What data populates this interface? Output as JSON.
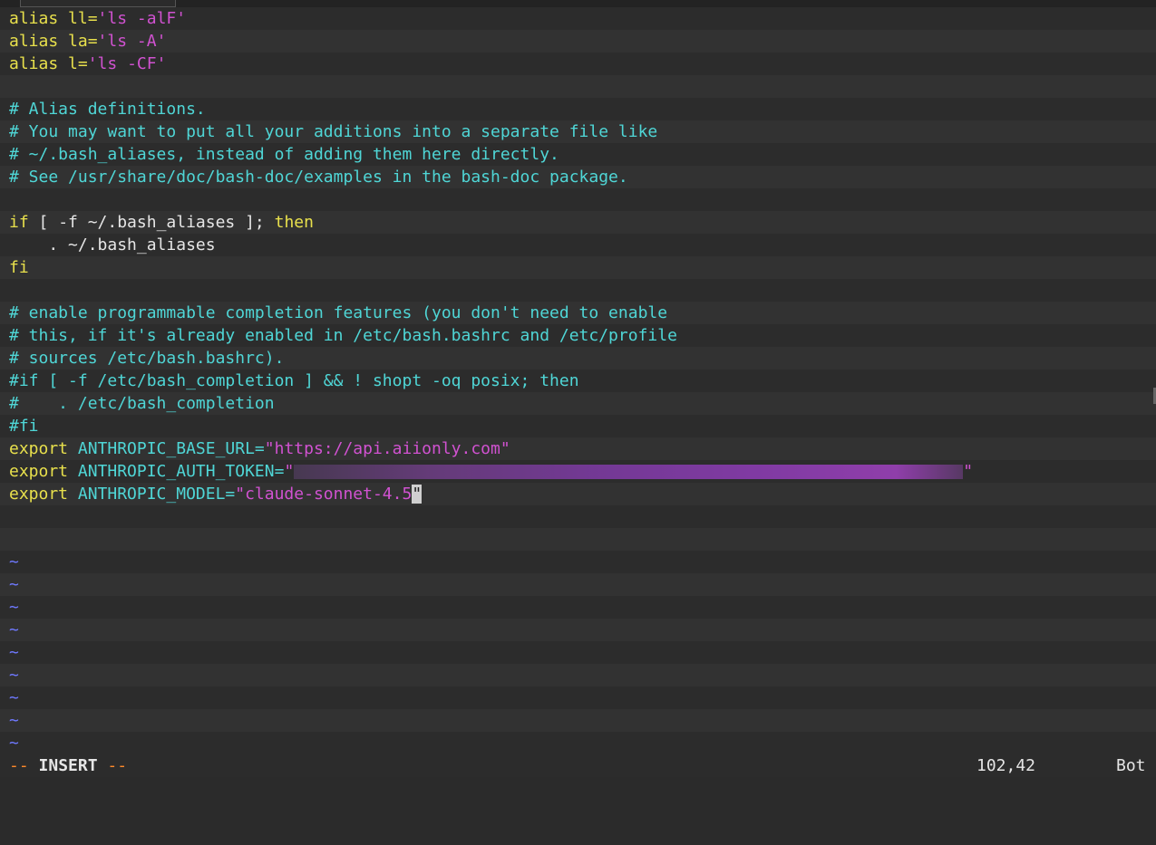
{
  "lines": {
    "l0_kw": "alias ",
    "l0_plain": "ll=",
    "l0_str": "'ls -alF'",
    "l1_kw": "alias ",
    "l1_plain": "la=",
    "l1_str": "'ls -A'",
    "l2_kw": "alias ",
    "l2_plain": "l=",
    "l2_str": "'ls -CF'",
    "c1": "# Alias definitions.",
    "c2": "# You may want to put all your additions into a separate file like",
    "c3": "# ~/.bash_aliases, instead of adding them here directly.",
    "c4": "# See /usr/share/doc/bash-doc/examples in the bash-doc package.",
    "if_kw": "if",
    "if_plain": " [ -f ~/.bash_aliases ]; ",
    "if_then": "then",
    "source_line": "    . ~/.bash_aliases",
    "fi": "fi",
    "c5": "# enable programmable completion features (you don't need to enable",
    "c6": "# this, if it's already enabled in /etc/bash.bashrc and /etc/profile",
    "c7": "# sources /etc/bash.bashrc).",
    "c8": "#if [ -f /etc/bash_completion ] && ! shopt -oq posix; then",
    "c9": "#    . /etc/bash_completion",
    "c10": "#fi",
    "exp1_kw": "export ",
    "exp1_plain": "ANTHROPIC_BASE_URL=",
    "exp1_str": "\"https://api.aiionly.com\"",
    "exp2_kw": "export ",
    "exp2_plain": "ANTHROPIC_AUTH_TOKEN=",
    "exp2_q1": "\"",
    "exp2_q2": "\"",
    "exp3_kw": "export ",
    "exp3_plain": "ANTHROPIC_MODEL=",
    "exp3_str": "\"claude-sonnet-4.5",
    "exp3_cursor": "\"",
    "tilde": "~"
  },
  "status": {
    "mode_dash_left": "-- ",
    "mode": "INSERT",
    "mode_dash_right": " --",
    "position": "102,42",
    "scroll": "Bot"
  }
}
